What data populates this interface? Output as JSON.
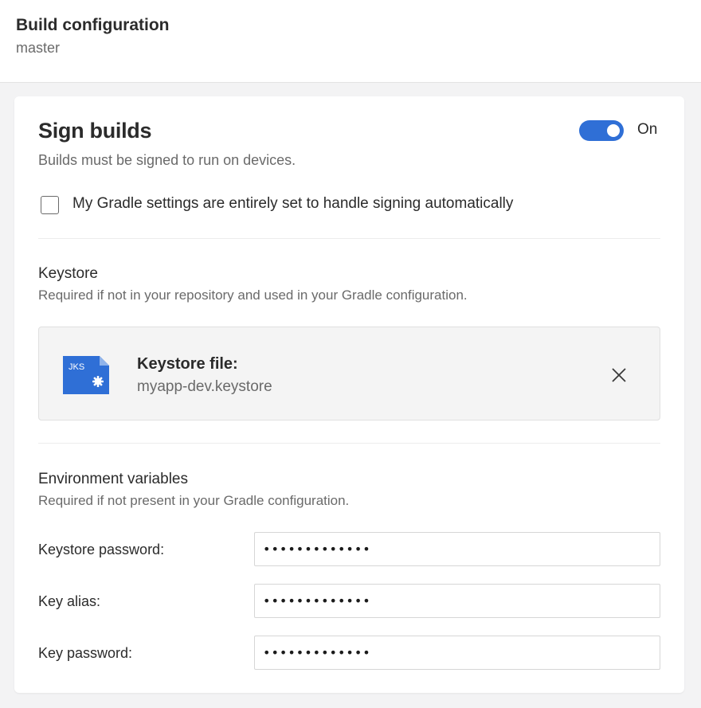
{
  "header": {
    "title": "Build configuration",
    "branch": "master"
  },
  "sign_builds": {
    "title": "Sign builds",
    "description": "Builds must be signed to run on devices.",
    "toggle": {
      "state": "on",
      "label": "On",
      "color": "#2f6fd6"
    },
    "gradle_checkbox": {
      "checked": false,
      "label": "My Gradle settings are entirely set to handle signing automatically"
    }
  },
  "keystore": {
    "title": "Keystore",
    "description": "Required if not in your repository and used in your Gradle configuration.",
    "file": {
      "icon_text": "JKS",
      "icon": "jks-file-icon",
      "label": "Keystore file:",
      "name": "myapp-dev.keystore",
      "remove_icon": "close-icon"
    }
  },
  "env_vars": {
    "title": "Environment variables",
    "description": "Required if not present in your Gradle configuration.",
    "fields": [
      {
        "label": "Keystore password:",
        "value": "•••••••••••••"
      },
      {
        "label": "Key alias:",
        "value": "•••••••••••••"
      },
      {
        "label": "Key password:",
        "value": "•••••••••••••"
      }
    ]
  }
}
